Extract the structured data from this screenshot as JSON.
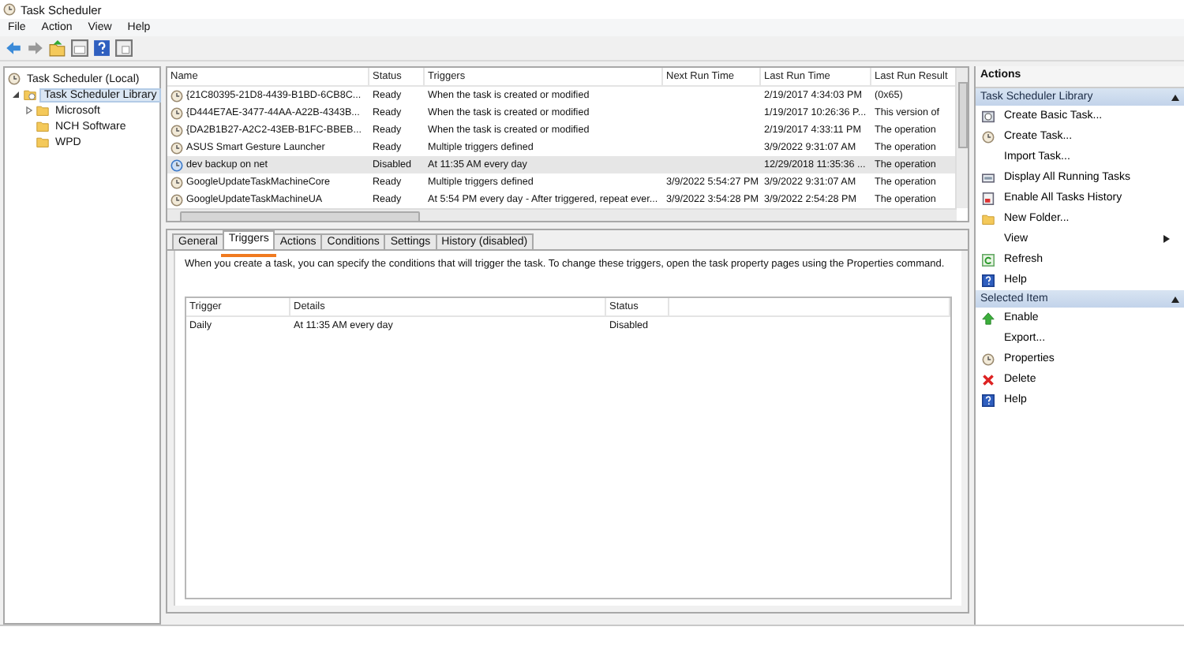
{
  "window": {
    "title": "Task Scheduler"
  },
  "menu": [
    "File",
    "Action",
    "View",
    "Help"
  ],
  "tree": [
    {
      "label": "Task Scheduler (Local)",
      "selected": false,
      "children": [
        {
          "label": "Task Scheduler Library",
          "selected": true,
          "expanded": true,
          "children": [
            {
              "label": "Microsoft",
              "selected": false,
              "expanded": false
            },
            {
              "label": "NCH Software",
              "selected": false
            },
            {
              "label": "WPD",
              "selected": false
            }
          ]
        }
      ]
    }
  ],
  "task_table": {
    "columns": [
      "Name",
      "Status",
      "Triggers",
      "Next Run Time",
      "Last Run Time",
      "Last Run Result"
    ],
    "rows": [
      {
        "selected": false,
        "cells": [
          "{21C80395-21D8-4439-B1BD-6CB8C...",
          "Ready",
          "When the task is created or modified",
          "",
          "2/19/2017 4:34:03 PM",
          "(0x65)"
        ]
      },
      {
        "selected": false,
        "cells": [
          "{D444E7AE-3477-44AA-A22B-4343B...",
          "Ready",
          "When the task is created or modified",
          "",
          "1/19/2017 10:26:36 P...",
          "This version of"
        ]
      },
      {
        "selected": false,
        "cells": [
          "{DA2B1B27-A2C2-43EB-B1FC-BBEB...",
          "Ready",
          "When the task is created or modified",
          "",
          "2/19/2017 4:33:11 PM",
          "The operation"
        ]
      },
      {
        "selected": false,
        "cells": [
          "ASUS Smart Gesture Launcher",
          "Ready",
          "Multiple triggers defined",
          "",
          "3/9/2022 9:31:07 AM",
          "The operation"
        ]
      },
      {
        "selected": true,
        "cells": [
          "dev backup on net",
          "Disabled",
          "At 11:35 AM every day",
          "",
          "12/29/2018 11:35:36 ...",
          "The operation"
        ]
      },
      {
        "selected": false,
        "cells": [
          "GoogleUpdateTaskMachineCore",
          "Ready",
          "Multiple triggers defined",
          "3/9/2022 5:54:27 PM",
          "3/9/2022 9:31:07 AM",
          "The operation"
        ]
      },
      {
        "selected": false,
        "cells": [
          "GoogleUpdateTaskMachineUA",
          "Ready",
          "At 5:54 PM every day - After triggered, repeat ever...",
          "3/9/2022 3:54:28 PM",
          "3/9/2022 2:54:28 PM",
          "The operation"
        ]
      }
    ]
  },
  "tabs": [
    {
      "label": "General",
      "selected": false
    },
    {
      "label": "Triggers",
      "selected": true
    },
    {
      "label": "Actions",
      "selected": false
    },
    {
      "label": "Conditions",
      "selected": false
    },
    {
      "label": "Settings",
      "selected": false
    },
    {
      "label": "History (disabled)",
      "selected": false
    }
  ],
  "triggers_pane": {
    "description": "When you create a task, you can specify the conditions that will trigger the task.  To change these triggers, open the task property pages using the Properties command.",
    "columns": [
      "Trigger",
      "Details",
      "Status"
    ],
    "rows": [
      {
        "cells": [
          "Daily",
          "At 11:35 AM every day",
          "Disabled"
        ]
      }
    ]
  },
  "actions_panel": {
    "title": "Actions",
    "sections": [
      {
        "title": "Task Scheduler Library",
        "items": [
          {
            "label": "Create Basic Task...",
            "kind": "wizard"
          },
          {
            "label": "Create Task...",
            "kind": "task"
          },
          {
            "label": "Import Task...",
            "kind": "plain"
          },
          {
            "label": "Display All Running Tasks",
            "kind": "running"
          },
          {
            "label": "Enable All Tasks History",
            "kind": "history"
          },
          {
            "label": "New Folder...",
            "kind": "folder"
          },
          {
            "label": "View",
            "kind": "plain",
            "submenu": true
          },
          {
            "label": "Refresh",
            "kind": "refresh"
          },
          {
            "label": "Help",
            "kind": "help"
          }
        ]
      },
      {
        "title": "Selected Item",
        "items": [
          {
            "label": "Enable",
            "kind": "enable"
          },
          {
            "label": "Export...",
            "kind": "plain"
          },
          {
            "label": "Properties",
            "kind": "task"
          },
          {
            "label": "Delete",
            "kind": "delete"
          },
          {
            "label": "Help",
            "kind": "help"
          }
        ]
      }
    ]
  }
}
